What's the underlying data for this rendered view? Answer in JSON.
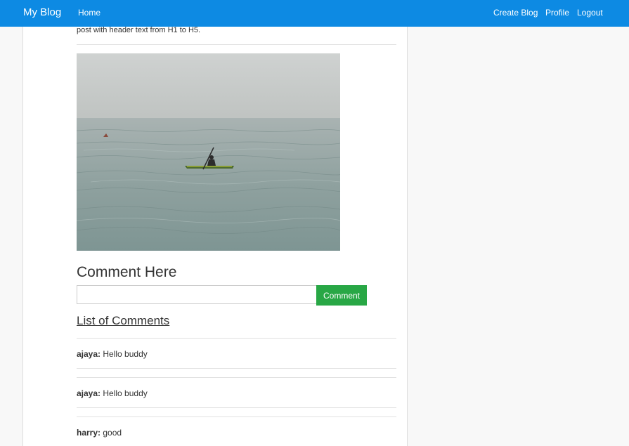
{
  "nav": {
    "brand": "My Blog",
    "home": "Home",
    "create_blog": "Create Blog",
    "profile": "Profile",
    "logout": "Logout"
  },
  "post": {
    "text_fragment": "post with header text from H1 to H5."
  },
  "comment_form": {
    "heading": "Comment Here",
    "input_value": "",
    "button_label": "Comment"
  },
  "comments_section": {
    "heading": "List of Comments",
    "items": [
      {
        "author": "ajaya:",
        "text": "Hello buddy"
      },
      {
        "author": "ajaya:",
        "text": "Hello buddy"
      },
      {
        "author": "harry:",
        "text": "good"
      }
    ]
  },
  "colors": {
    "navbar": "#0d8ae3",
    "comment_button": "#28a745",
    "page_background": "#f8f8f8"
  }
}
